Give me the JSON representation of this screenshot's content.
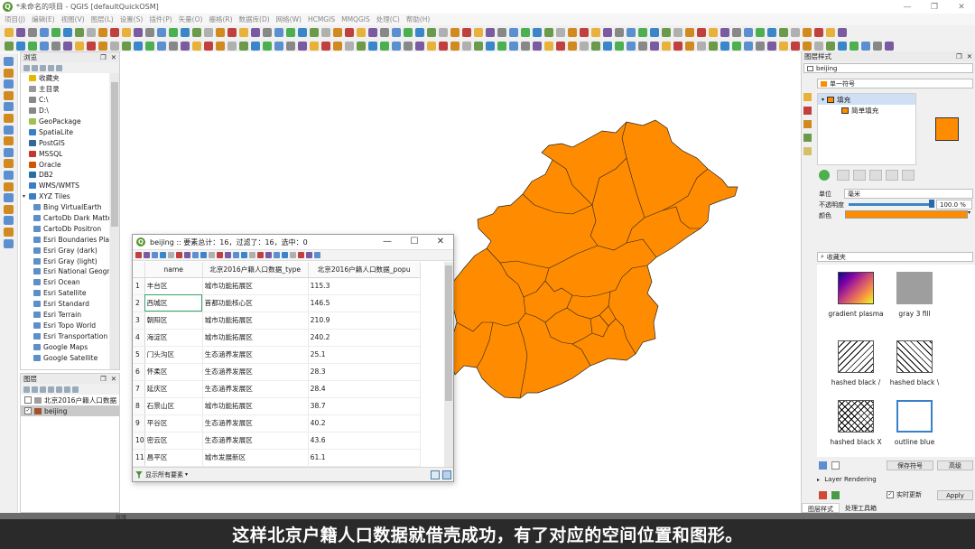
{
  "window": {
    "title": "*未命名的项目 - QGIS [defaultQuickOSM]",
    "minimize": "—",
    "maximize": "❐",
    "close": "✕"
  },
  "menubar": [
    "项目(J)",
    "编辑(E)",
    "视图(V)",
    "图层(L)",
    "设置(S)",
    "插件(P)",
    "矢量(O)",
    "栅格(R)",
    "数据库(D)",
    "网络(W)",
    "HCMGIS",
    "MMQGIS",
    "处理(C)",
    "帮助(H)"
  ],
  "browser": {
    "title": "浏览",
    "items": [
      {
        "label": "收藏夹",
        "icon": "star-icon",
        "color": "#e6b800",
        "arrow": ""
      },
      {
        "label": "主目录",
        "icon": "home-folder-icon",
        "color": "#999999",
        "arrow": ""
      },
      {
        "label": "C:\\",
        "icon": "drive-icon",
        "color": "#888888",
        "arrow": ""
      },
      {
        "label": "D:\\",
        "icon": "drive-icon",
        "color": "#888888",
        "arrow": ""
      },
      {
        "label": "GeoPackage",
        "icon": "geopackage-icon",
        "color": "#a0c050",
        "arrow": ""
      },
      {
        "label": "SpatiaLite",
        "icon": "spatialite-icon",
        "color": "#3a7ec6",
        "arrow": ""
      },
      {
        "label": "PostGIS",
        "icon": "postgis-icon",
        "color": "#336699",
        "arrow": ""
      },
      {
        "label": "MSSQL",
        "icon": "mssql-icon",
        "color": "#c0392b",
        "arrow": ""
      },
      {
        "label": "Oracle",
        "icon": "oracle-icon",
        "color": "#d35400",
        "arrow": ""
      },
      {
        "label": "DB2",
        "icon": "db2-icon",
        "color": "#2471a3",
        "arrow": ""
      },
      {
        "label": "WMS/WMTS",
        "icon": "wms-icon",
        "color": "#3a7ec6",
        "arrow": ""
      },
      {
        "label": "XYZ Tiles",
        "icon": "xyz-tiles-icon",
        "color": "#3a7ec6",
        "arrow": "▾"
      },
      {
        "label": "Bing VirtualEarth",
        "icon": "tile-layer-icon",
        "color": "#5d8fc9",
        "arrow": "",
        "indent": true
      },
      {
        "label": "CartoDb Dark Matter",
        "icon": "tile-layer-icon",
        "color": "#5d8fc9",
        "arrow": "",
        "indent": true
      },
      {
        "label": "CartoDb Positron",
        "icon": "tile-layer-icon",
        "color": "#5d8fc9",
        "arrow": "",
        "indent": true
      },
      {
        "label": "Esri Boundaries Place",
        "icon": "tile-layer-icon",
        "color": "#5d8fc9",
        "arrow": "",
        "indent": true
      },
      {
        "label": "Esri Gray (dark)",
        "icon": "tile-layer-icon",
        "color": "#5d8fc9",
        "arrow": "",
        "indent": true
      },
      {
        "label": "Esri Gray (light)",
        "icon": "tile-layer-icon",
        "color": "#5d8fc9",
        "arrow": "",
        "indent": true
      },
      {
        "label": "Esri National Geogra",
        "icon": "tile-layer-icon",
        "color": "#5d8fc9",
        "arrow": "",
        "indent": true
      },
      {
        "label": "Esri Ocean",
        "icon": "tile-layer-icon",
        "color": "#5d8fc9",
        "arrow": "",
        "indent": true
      },
      {
        "label": "Esri Satellite",
        "icon": "tile-layer-icon",
        "color": "#5d8fc9",
        "arrow": "",
        "indent": true
      },
      {
        "label": "Esri Standard",
        "icon": "tile-layer-icon",
        "color": "#5d8fc9",
        "arrow": "",
        "indent": true
      },
      {
        "label": "Esri Terrain",
        "icon": "tile-layer-icon",
        "color": "#5d8fc9",
        "arrow": "",
        "indent": true
      },
      {
        "label": "Esri Topo World",
        "icon": "tile-layer-icon",
        "color": "#5d8fc9",
        "arrow": "",
        "indent": true
      },
      {
        "label": "Esri Transportation",
        "icon": "tile-layer-icon",
        "color": "#5d8fc9",
        "arrow": "",
        "indent": true
      },
      {
        "label": "Google Maps",
        "icon": "tile-layer-icon",
        "color": "#5d8fc9",
        "arrow": "",
        "indent": true
      },
      {
        "label": "Google Satellite",
        "icon": "tile-layer-icon",
        "color": "#5d8fc9",
        "arrow": "",
        "indent": true
      }
    ]
  },
  "layers": {
    "title": "图层",
    "items": [
      {
        "label": "北京2016户籍人口数据",
        "checked": false,
        "type": "table-layer-icon",
        "color": "#9e9e9e"
      },
      {
        "label": "beijing",
        "checked": true,
        "type": "polygon-layer-icon",
        "color": "#a0522d"
      }
    ]
  },
  "map": {
    "fill_color": "#ff8c00",
    "stroke_color": "#232323"
  },
  "attribute_table": {
    "title": "beijing :: 要素总计：16，过滤了：16，选中：0",
    "columns": [
      "name",
      "北京2016户籍人口数据_type",
      "北京2016户籍人口数据_popu"
    ],
    "rows": [
      {
        "n": "1",
        "name": "丰台区",
        "type": "城市功能拓展区",
        "popu": "115.3"
      },
      {
        "n": "2",
        "name": "西城区",
        "type": "首都功能核心区",
        "popu": "146.5"
      },
      {
        "n": "3",
        "name": "朝阳区",
        "type": "城市功能拓展区",
        "popu": "210.9"
      },
      {
        "n": "4",
        "name": "海淀区",
        "type": "城市功能拓展区",
        "popu": "240.2"
      },
      {
        "n": "5",
        "name": "门头沟区",
        "type": "生态涵养发展区",
        "popu": "25.1"
      },
      {
        "n": "6",
        "name": "怀柔区",
        "type": "生态涵养发展区",
        "popu": "28.3"
      },
      {
        "n": "7",
        "name": "延庆区",
        "type": "生态涵养发展区",
        "popu": "28.4"
      },
      {
        "n": "8",
        "name": "石景山区",
        "type": "城市功能拓展区",
        "popu": "38.7"
      },
      {
        "n": "9",
        "name": "平谷区",
        "type": "生态涵养发展区",
        "popu": "40.2"
      },
      {
        "n": "10",
        "name": "密云区",
        "type": "生态涵养发展区",
        "popu": "43.6"
      },
      {
        "n": "11",
        "name": "昌平区",
        "type": "城市发展新区",
        "popu": "61.1"
      }
    ],
    "footer": "显示所有要素"
  },
  "style_panel": {
    "title": "图层样式",
    "layer": "beijing",
    "renderer": "单一符号",
    "tree_fill": "填充",
    "tree_simple_fill": "简单填充",
    "symbol_color": "#ff8c00",
    "unit_label": "单位",
    "unit_value": "毫米",
    "opacity_label": "不透明度",
    "opacity_value": "100.0 %",
    "color_label": "颜色",
    "search_placeholder": "收藏夹",
    "symbols": [
      {
        "label": "gradient plasma",
        "kind": "gradient"
      },
      {
        "label": "gray 3 fill",
        "kind": "gray"
      },
      {
        "label": "hashed black /",
        "kind": "hash-fwd"
      },
      {
        "label": "hashed black \\",
        "kind": "hash-back"
      },
      {
        "label": "hashed black X",
        "kind": "hash-x"
      },
      {
        "label": "outline blue",
        "kind": "outline-blue"
      }
    ],
    "save_symbol": "保存符号",
    "advanced": "高级",
    "layer_rendering": "Layer Rendering",
    "live_update": "实时更新",
    "apply": "Apply",
    "tab_style": "图层样式",
    "tab_processing": "处理工具箱"
  },
  "status": {
    "text": "就绪"
  },
  "subtitle": "这样北京户籍人口数据就借壳成功，有了对应的空间位置和图形。"
}
